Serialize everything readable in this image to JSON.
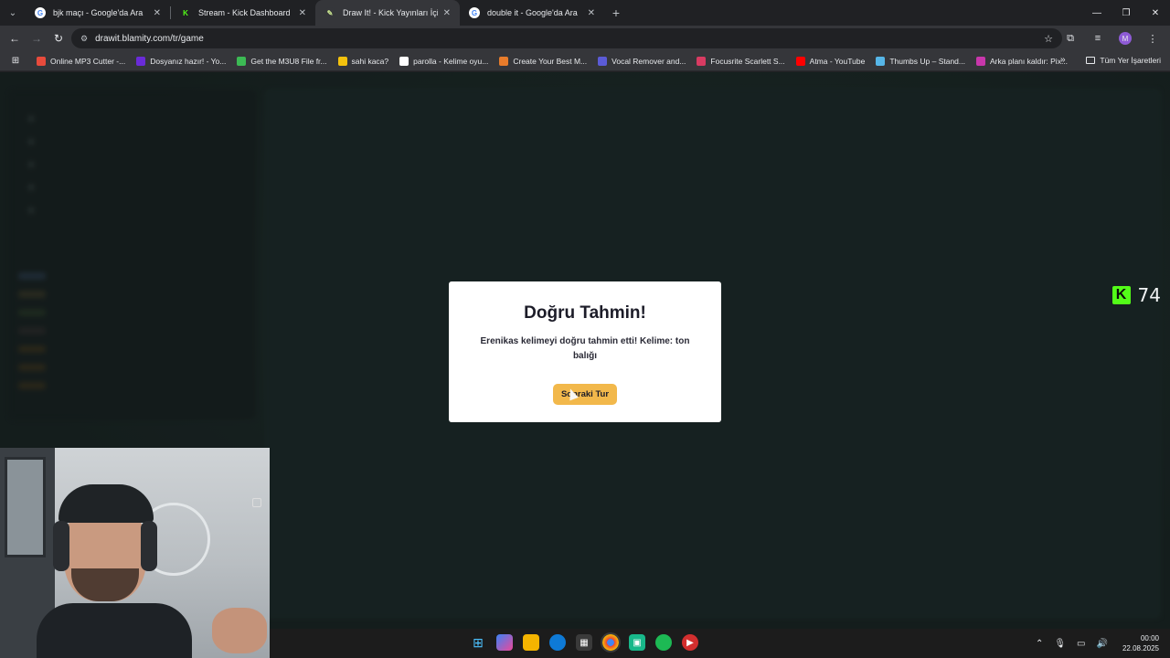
{
  "browser": {
    "tabs": [
      {
        "title": "bjk maçı - Google'da Ara",
        "favicon": "google-icon",
        "active": false
      },
      {
        "title": "Stream - Kick Dashboard",
        "favicon": "kick-icon",
        "active": false
      },
      {
        "title": "Draw It! - Kick Yayınları İçin Çiz",
        "favicon": "drawit-icon",
        "active": true
      },
      {
        "title": "double it - Google'da Ara",
        "favicon": "google-icon",
        "active": false
      }
    ],
    "url": "drawit.blamity.com/tr/game",
    "bookmarks": [
      {
        "label": "Online MP3 Cutter -...",
        "color": "#e84b3c"
      },
      {
        "label": "Dosyanız hazır! - Yo...",
        "color": "#6a2bd8"
      },
      {
        "label": "Get the M3U8 File fr...",
        "color": "#3cba54"
      },
      {
        "label": "sahi kaca?",
        "color": "#f4c20d"
      },
      {
        "label": "parolla - Kelime oyu...",
        "color": "#ffffff"
      },
      {
        "label": "Create Your Best M...",
        "color": "#e87c2b"
      },
      {
        "label": "Vocal Remover and...",
        "color": "#5b5bd6"
      },
      {
        "label": "Focusrite Scarlett S...",
        "color": "#d83b62"
      },
      {
        "label": "Atma - YouTube",
        "color": "#ff0000"
      },
      {
        "label": "Thumbs Up – Stand...",
        "color": "#56b6e8"
      },
      {
        "label": "Arka planı kaldır: Pix...",
        "color": "#c837ab"
      }
    ],
    "all_bookmarks": "Tüm Yer İşaretleri",
    "profile_initial": "M"
  },
  "modal": {
    "title": "Doğru Tahmin!",
    "message": "Erenikas kelimeyi doğru tahmin etti! Kelime: ton balığı",
    "next_button": "Sonraki Tur"
  },
  "viewer_count": "74",
  "taskbar": {
    "time": "00:00",
    "date": "22.08.2025"
  },
  "colors": {
    "kick_green": "#53fc18",
    "button_accent": "#f2b84b"
  }
}
